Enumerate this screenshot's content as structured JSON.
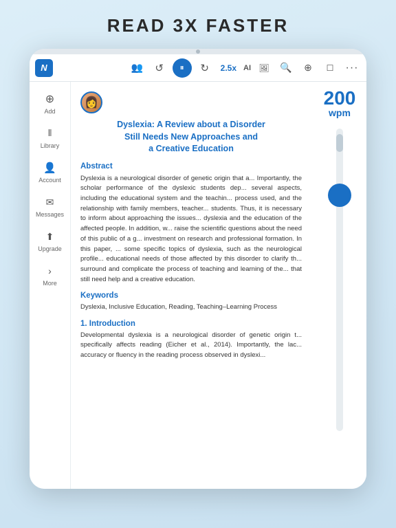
{
  "headline": "READ 3X FASTER",
  "toolbar": {
    "logo": "N",
    "speed": "2.5x",
    "ai_label": "AI",
    "icons": {
      "people": "👥",
      "undo": "↺",
      "pause": "⏸",
      "redo": "↻",
      "search": "🔍",
      "zoom_in": "⊕",
      "bookmark": "🔖",
      "more": "···"
    }
  },
  "sidebar": {
    "items": [
      {
        "label": "Add",
        "icon": "⊕"
      },
      {
        "label": "Library",
        "icon": "|||"
      },
      {
        "label": "Account",
        "icon": "👤"
      },
      {
        "label": "Messages",
        "icon": "✉"
      },
      {
        "label": "Upgrade",
        "icon": "↑"
      },
      {
        "label": "More",
        "icon": ">"
      }
    ]
  },
  "wpm": {
    "number": "200",
    "label": "wpm"
  },
  "document": {
    "title_line1": "Dyslexia: A Review about a Disorder",
    "title_line2": "Still Needs New Approaches and",
    "title_line3": "a Creative Education",
    "abstract_title": "Abstract",
    "abstract_body": "Dyslexia is a neurological disorder of genetic origin that a... Importantly, the scholar performance of the dyslexic students dep... several aspects, including the educational system and the teachin... process used, and the relationship with family members, teacher... students. Thus, it is necessary to inform about approaching the issues... dyslexia and the education of the affected people. In addition, w... raise the scientific questions about the need of this public of a g... investment on research and professional formation. In this paper, ... some specific topics of dyslexia, such as the neurological profile... educational needs of those affected by this disorder to clarify th... surround and complicate the process of teaching and learning of the... that still need help and a creative education.",
    "keywords_title": "Keywords",
    "keywords_body": "Dyslexia, Inclusive Education, Reading, Teaching–Learning Process",
    "intro_title": "1. Introduction",
    "intro_body": "Developmental dyslexia is a neurological disorder of genetic origin t... specifically affects reading (Eicher et al., 2014). Importantly, the lac... accuracy or fluency in the reading process observed in dyslexi..."
  }
}
